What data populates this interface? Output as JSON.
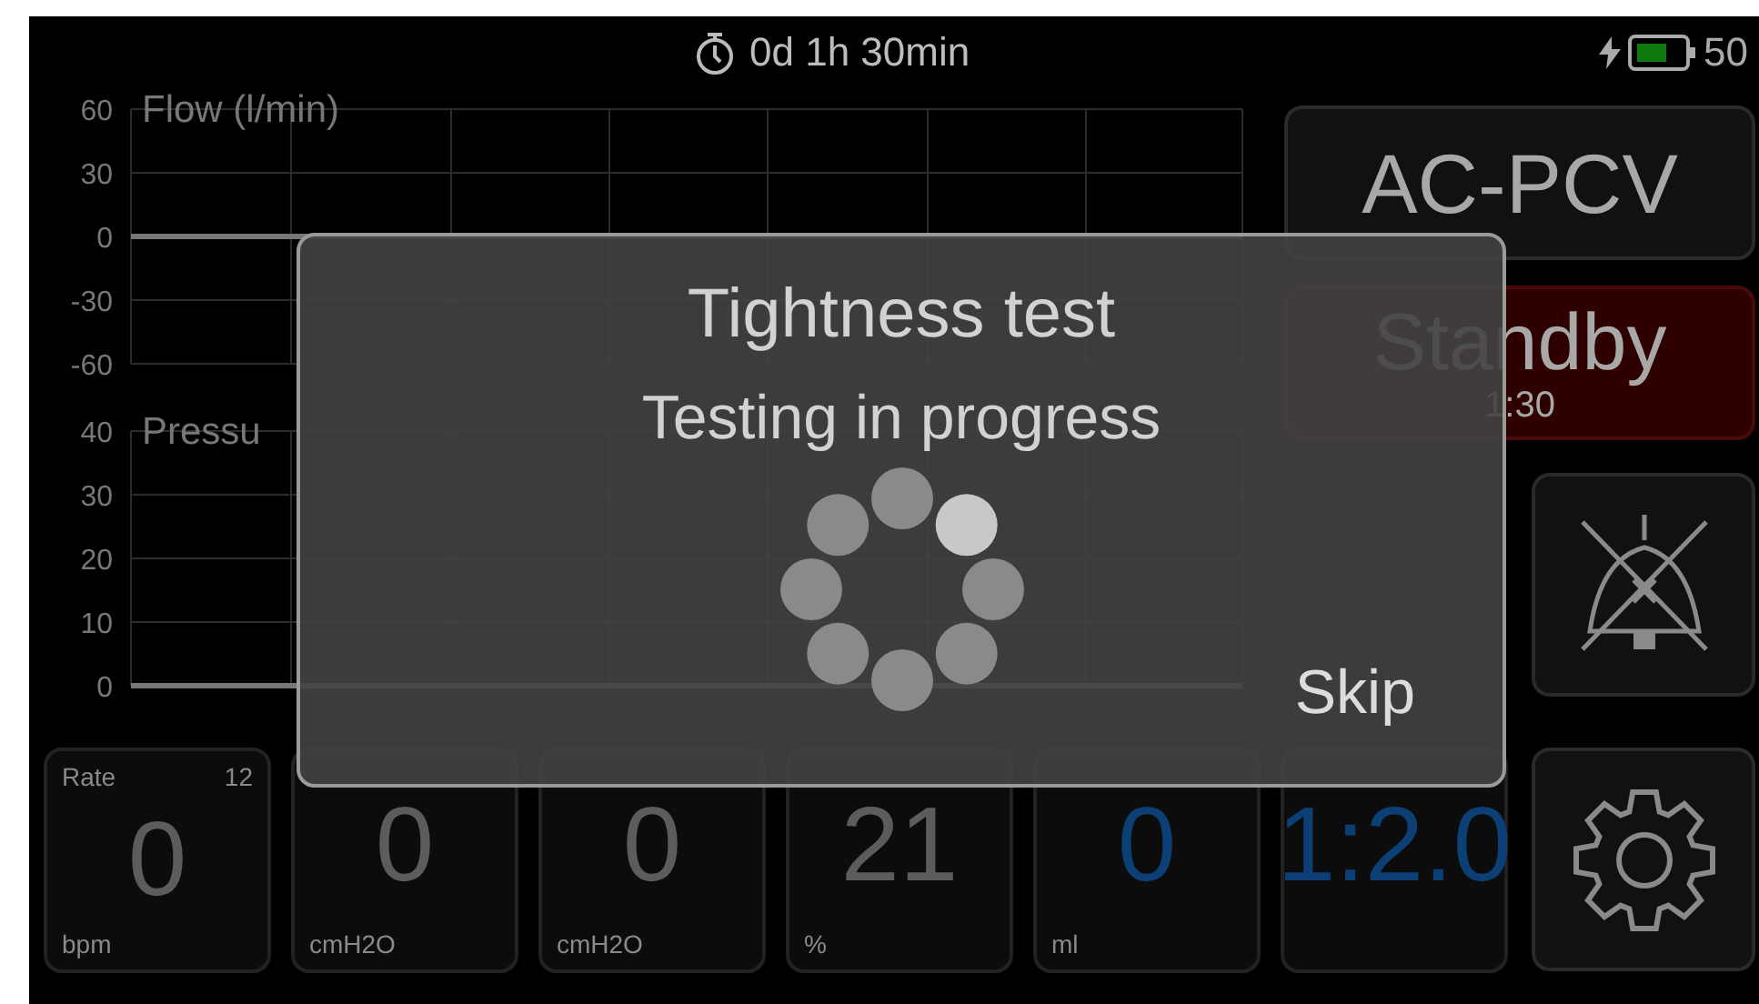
{
  "status_bar": {
    "elapsed": "0d 1h 30min",
    "battery": "50"
  },
  "charts": [
    {
      "title": "Flow (l/min)",
      "axis_labels": [
        "60",
        "30",
        "0",
        "-30",
        "-60"
      ]
    },
    {
      "title": "Pressu",
      "axis_labels": [
        "40",
        "30",
        "20",
        "10",
        "0"
      ]
    }
  ],
  "mode_button": "AC-PCV",
  "standby": {
    "label": "Standby",
    "time": "1:30"
  },
  "tiles": [
    {
      "label": "Rate",
      "setting": "12",
      "value": "0",
      "unit": "bpm",
      "color": "#5c5c5c"
    },
    {
      "value": "0",
      "unit": "cmH2O",
      "color": "#5c5c5c"
    },
    {
      "value": "0",
      "unit": "cmH2O",
      "color": "#5c5c5c"
    },
    {
      "value": "21",
      "unit": "%",
      "color": "#5c5c5c"
    },
    {
      "value": "0",
      "unit": "ml",
      "color": "#0c3f75"
    },
    {
      "value": "1:2.0",
      "color": "#0c3f75"
    }
  ],
  "dialog": {
    "title": "Tightness test",
    "message": "Testing in progress",
    "skip": "Skip"
  }
}
